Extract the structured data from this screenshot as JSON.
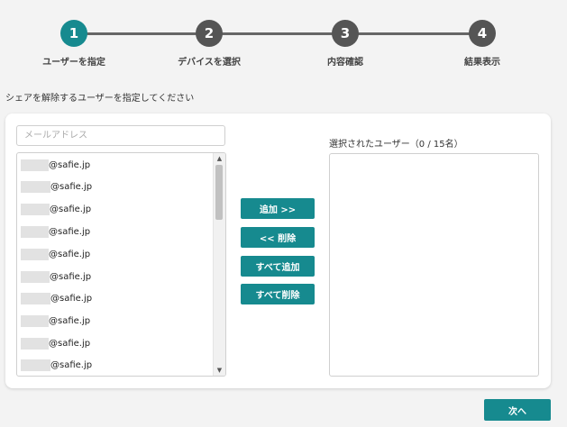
{
  "stepper": {
    "steps": [
      {
        "number": "1",
        "label": "ユーザーを指定",
        "active": true
      },
      {
        "number": "2",
        "label": "デバイスを選択",
        "active": false
      },
      {
        "number": "3",
        "label": "内容確認",
        "active": false
      },
      {
        "number": "4",
        "label": "結果表示",
        "active": false
      }
    ]
  },
  "instruction": "シェアを解除するユーザーを指定してください",
  "search": {
    "value": "",
    "placeholder": "メールアドレス"
  },
  "available_users": [
    {
      "email_suffix": "@safie.jp"
    },
    {
      "email_suffix": "@safie.jp"
    },
    {
      "email_suffix": "@safie.jp"
    },
    {
      "email_suffix": "@safie.jp"
    },
    {
      "email_suffix": "@safie.jp"
    },
    {
      "email_suffix": "@safie.jp"
    },
    {
      "email_suffix": "@safie.jp"
    },
    {
      "email_suffix": "@safie.jp"
    },
    {
      "email_suffix": "@safie.jp"
    },
    {
      "email_suffix": "@safie.jp"
    }
  ],
  "buttons": {
    "add": "追加 >>",
    "remove": "<< 削除",
    "add_all": "すべて追加",
    "remove_all": "すべて削除",
    "next": "次へ"
  },
  "selected": {
    "label": "選択されたユーザー（0 / 15名）",
    "items": []
  },
  "colors": {
    "accent": "#168a8f",
    "inactive_step": "#555555"
  }
}
